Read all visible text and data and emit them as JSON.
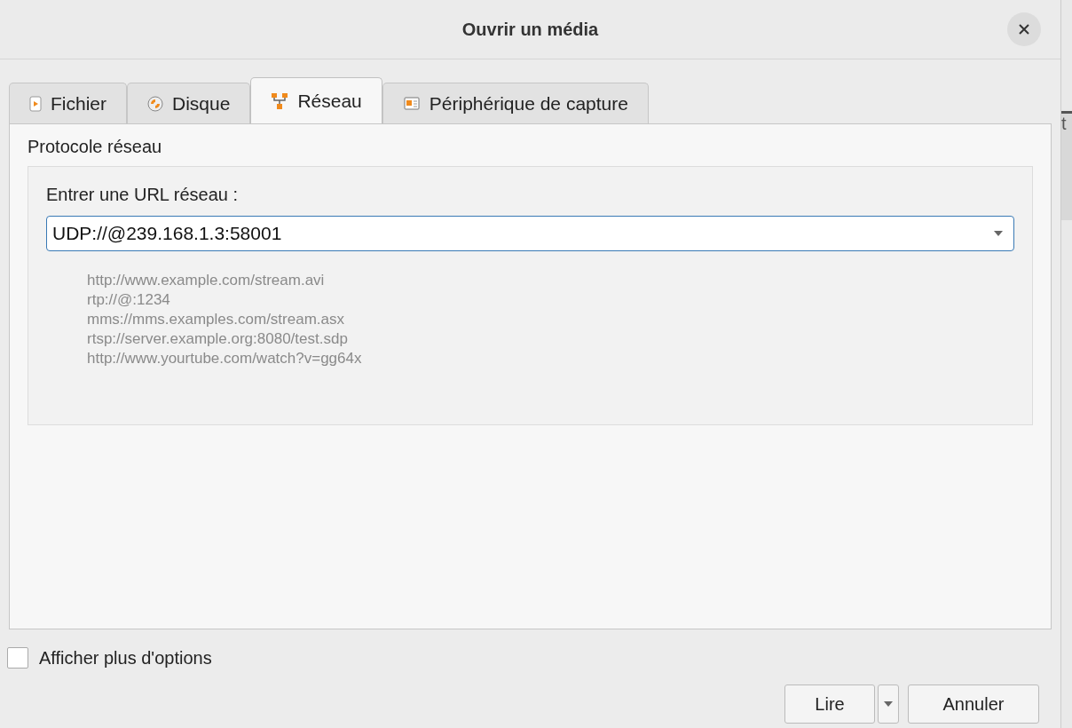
{
  "window": {
    "title": "Ouvrir un média"
  },
  "tabs": [
    {
      "label": "Fichier",
      "kind": "file",
      "selected": false
    },
    {
      "label": "Disque",
      "kind": "disc",
      "selected": false
    },
    {
      "label": "Réseau",
      "kind": "network",
      "selected": true
    },
    {
      "label": "Périphérique de capture",
      "kind": "capture",
      "selected": false
    }
  ],
  "group": {
    "title": "Protocole réseau",
    "url_label": "Entrer une URL réseau :",
    "url_value": "UDP://@239.168.1.3:58001",
    "examples": [
      "http://www.example.com/stream.avi",
      "rtp://@:1234",
      "mms://mms.examples.com/stream.asx",
      "rtsp://server.example.org:8080/test.sdp",
      "http://www.yourtube.com/watch?v=gg64x"
    ]
  },
  "more_options": {
    "label": "Afficher plus d'options",
    "checked": false
  },
  "buttons": {
    "play": "Lire",
    "cancel": "Annuler"
  },
  "background_window": {
    "texts": [
      "t"
    ]
  }
}
